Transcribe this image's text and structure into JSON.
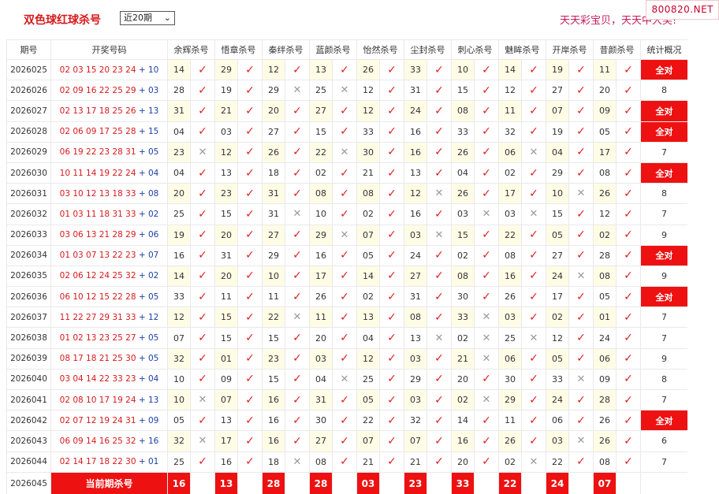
{
  "header": {
    "title": "双色球红球杀号",
    "select_value": "近20期",
    "slogan": "天天彩宝贝，天天中大奖!",
    "brand": "800820.NET"
  },
  "table": {
    "columns": [
      "期号",
      "开奖号码",
      "余辉杀号",
      "悟章杀号",
      "秦绊杀号",
      "蓝颜杀号",
      "怡然杀号",
      "尘封杀号",
      "刺心杀号",
      "魅眸杀号",
      "开岸杀号",
      "昔颜杀号",
      "统计概况"
    ],
    "rows": [
      {
        "issue": "2026025",
        "red": "02 03 15 20 23 24",
        "blue": "10",
        "kills": [
          [
            "14",
            "y"
          ],
          [
            "29",
            "y"
          ],
          [
            "12",
            "y"
          ],
          [
            "13",
            "y"
          ],
          [
            "26",
            "y"
          ],
          [
            "33",
            "y"
          ],
          [
            "10",
            "y"
          ],
          [
            "14",
            "y"
          ],
          [
            "19",
            "y"
          ],
          [
            "11",
            "y"
          ]
        ],
        "stat": "全对"
      },
      {
        "issue": "2026026",
        "red": "02 09 16 22 25 29",
        "blue": "03",
        "kills": [
          [
            "28",
            "y"
          ],
          [
            "19",
            "y"
          ],
          [
            "29",
            "n"
          ],
          [
            "25",
            "n"
          ],
          [
            "12",
            "y"
          ],
          [
            "31",
            "y"
          ],
          [
            "15",
            "y"
          ],
          [
            "12",
            "y"
          ],
          [
            "27",
            "y"
          ],
          [
            "20",
            "y"
          ]
        ],
        "stat": "8"
      },
      {
        "issue": "2026027",
        "red": "02 13 17 18 25 26",
        "blue": "13",
        "kills": [
          [
            "31",
            "y"
          ],
          [
            "21",
            "y"
          ],
          [
            "20",
            "y"
          ],
          [
            "27",
            "y"
          ],
          [
            "12",
            "y"
          ],
          [
            "24",
            "y"
          ],
          [
            "08",
            "y"
          ],
          [
            "11",
            "y"
          ],
          [
            "07",
            "y"
          ],
          [
            "09",
            "y"
          ]
        ],
        "stat": "全对"
      },
      {
        "issue": "2026028",
        "red": "02 06 09 17 25 28",
        "blue": "15",
        "kills": [
          [
            "04",
            "y"
          ],
          [
            "03",
            "y"
          ],
          [
            "27",
            "y"
          ],
          [
            "15",
            "y"
          ],
          [
            "33",
            "y"
          ],
          [
            "16",
            "y"
          ],
          [
            "33",
            "y"
          ],
          [
            "32",
            "y"
          ],
          [
            "19",
            "y"
          ],
          [
            "05",
            "y"
          ]
        ],
        "stat": "全对"
      },
      {
        "issue": "2026029",
        "red": "06 19 22 23 28 31",
        "blue": "05",
        "kills": [
          [
            "23",
            "n"
          ],
          [
            "12",
            "y"
          ],
          [
            "26",
            "y"
          ],
          [
            "22",
            "n"
          ],
          [
            "30",
            "y"
          ],
          [
            "16",
            "y"
          ],
          [
            "26",
            "y"
          ],
          [
            "06",
            "n"
          ],
          [
            "04",
            "y"
          ],
          [
            "17",
            "y"
          ]
        ],
        "stat": "7"
      },
      {
        "issue": "2026030",
        "red": "10 11 14 19 22 24",
        "blue": "04",
        "kills": [
          [
            "04",
            "y"
          ],
          [
            "13",
            "y"
          ],
          [
            "18",
            "y"
          ],
          [
            "02",
            "y"
          ],
          [
            "21",
            "y"
          ],
          [
            "13",
            "y"
          ],
          [
            "04",
            "y"
          ],
          [
            "02",
            "y"
          ],
          [
            "29",
            "y"
          ],
          [
            "08",
            "y"
          ]
        ],
        "stat": "全对"
      },
      {
        "issue": "2026031",
        "red": "03 10 12 13 18 33",
        "blue": "08",
        "kills": [
          [
            "20",
            "y"
          ],
          [
            "23",
            "y"
          ],
          [
            "31",
            "y"
          ],
          [
            "08",
            "y"
          ],
          [
            "08",
            "y"
          ],
          [
            "12",
            "n"
          ],
          [
            "26",
            "y"
          ],
          [
            "17",
            "y"
          ],
          [
            "10",
            "n"
          ],
          [
            "26",
            "y"
          ]
        ],
        "stat": "8"
      },
      {
        "issue": "2026032",
        "red": "01 03 11 18 31 33",
        "blue": "02",
        "kills": [
          [
            "25",
            "y"
          ],
          [
            "15",
            "y"
          ],
          [
            "31",
            "n"
          ],
          [
            "10",
            "y"
          ],
          [
            "02",
            "y"
          ],
          [
            "16",
            "y"
          ],
          [
            "03",
            "n"
          ],
          [
            "03",
            "n"
          ],
          [
            "15",
            "y"
          ],
          [
            "12",
            "y"
          ]
        ],
        "stat": "7"
      },
      {
        "issue": "2026033",
        "red": "03 06 13 21 28 29",
        "blue": "06",
        "kills": [
          [
            "19",
            "y"
          ],
          [
            "20",
            "y"
          ],
          [
            "27",
            "y"
          ],
          [
            "29",
            "n"
          ],
          [
            "07",
            "y"
          ],
          [
            "03",
            "n"
          ],
          [
            "15",
            "y"
          ],
          [
            "22",
            "y"
          ],
          [
            "05",
            "y"
          ],
          [
            "02",
            "y"
          ]
        ],
        "stat": "9"
      },
      {
        "issue": "2026034",
        "red": "01 03 07 13 22 23",
        "blue": "07",
        "kills": [
          [
            "16",
            "y"
          ],
          [
            "31",
            "y"
          ],
          [
            "29",
            "y"
          ],
          [
            "16",
            "y"
          ],
          [
            "05",
            "y"
          ],
          [
            "24",
            "y"
          ],
          [
            "02",
            "y"
          ],
          [
            "08",
            "y"
          ],
          [
            "27",
            "y"
          ],
          [
            "28",
            "y"
          ]
        ],
        "stat": "全对"
      },
      {
        "issue": "2026035",
        "red": "02 06 12 24 25 32",
        "blue": "02",
        "kills": [
          [
            "14",
            "y"
          ],
          [
            "20",
            "y"
          ],
          [
            "10",
            "y"
          ],
          [
            "17",
            "y"
          ],
          [
            "14",
            "y"
          ],
          [
            "27",
            "y"
          ],
          [
            "08",
            "y"
          ],
          [
            "16",
            "y"
          ],
          [
            "24",
            "n"
          ],
          [
            "08",
            "y"
          ]
        ],
        "stat": "9"
      },
      {
        "issue": "2026036",
        "red": "06 10 12 15 22 28",
        "blue": "05",
        "kills": [
          [
            "33",
            "y"
          ],
          [
            "11",
            "y"
          ],
          [
            "11",
            "y"
          ],
          [
            "26",
            "y"
          ],
          [
            "02",
            "y"
          ],
          [
            "31",
            "y"
          ],
          [
            "30",
            "y"
          ],
          [
            "26",
            "y"
          ],
          [
            "17",
            "y"
          ],
          [
            "05",
            "y"
          ]
        ],
        "stat": "全对"
      },
      {
        "issue": "2026037",
        "red": "11 22 27 29 31 33",
        "blue": "12",
        "kills": [
          [
            "12",
            "y"
          ],
          [
            "15",
            "y"
          ],
          [
            "22",
            "n"
          ],
          [
            "11",
            "y"
          ],
          [
            "13",
            "y"
          ],
          [
            "08",
            "y"
          ],
          [
            "33",
            "n"
          ],
          [
            "03",
            "y"
          ],
          [
            "02",
            "y"
          ],
          [
            "01",
            "y"
          ]
        ],
        "stat": "7"
      },
      {
        "issue": "2026038",
        "red": "01 02 13 23 25 27",
        "blue": "05",
        "kills": [
          [
            "07",
            "y"
          ],
          [
            "15",
            "y"
          ],
          [
            "15",
            "y"
          ],
          [
            "20",
            "y"
          ],
          [
            "04",
            "y"
          ],
          [
            "13",
            "n"
          ],
          [
            "02",
            "n"
          ],
          [
            "25",
            "n"
          ],
          [
            "12",
            "y"
          ],
          [
            "24",
            "y"
          ]
        ],
        "stat": "7"
      },
      {
        "issue": "2026039",
        "red": "08 17 18 21 25 30",
        "blue": "05",
        "kills": [
          [
            "32",
            "y"
          ],
          [
            "01",
            "y"
          ],
          [
            "23",
            "y"
          ],
          [
            "03",
            "y"
          ],
          [
            "12",
            "y"
          ],
          [
            "03",
            "y"
          ],
          [
            "21",
            "n"
          ],
          [
            "06",
            "y"
          ],
          [
            "05",
            "y"
          ],
          [
            "06",
            "y"
          ]
        ],
        "stat": "9"
      },
      {
        "issue": "2026040",
        "red": "03 04 14 22 33 23",
        "blue": "04",
        "kills": [
          [
            "10",
            "y"
          ],
          [
            "09",
            "y"
          ],
          [
            "15",
            "y"
          ],
          [
            "04",
            "n"
          ],
          [
            "25",
            "y"
          ],
          [
            "29",
            "y"
          ],
          [
            "20",
            "y"
          ],
          [
            "30",
            "y"
          ],
          [
            "33",
            "n"
          ],
          [
            "09",
            "y"
          ]
        ],
        "stat": "8"
      },
      {
        "issue": "2026041",
        "red": "02 08 10 17 19 24",
        "blue": "13",
        "kills": [
          [
            "10",
            "n"
          ],
          [
            "07",
            "y"
          ],
          [
            "16",
            "y"
          ],
          [
            "31",
            "y"
          ],
          [
            "05",
            "y"
          ],
          [
            "03",
            "y"
          ],
          [
            "02",
            "n"
          ],
          [
            "29",
            "y"
          ],
          [
            "24",
            "y"
          ],
          [
            "28",
            "y"
          ]
        ],
        "stat": "7"
      },
      {
        "issue": "2026042",
        "red": "02 07 12 19 24 31",
        "blue": "09",
        "kills": [
          [
            "05",
            "y"
          ],
          [
            "13",
            "y"
          ],
          [
            "16",
            "y"
          ],
          [
            "30",
            "y"
          ],
          [
            "22",
            "y"
          ],
          [
            "32",
            "y"
          ],
          [
            "14",
            "y"
          ],
          [
            "11",
            "y"
          ],
          [
            "06",
            "y"
          ],
          [
            "26",
            "y"
          ]
        ],
        "stat": "全对"
      },
      {
        "issue": "2026043",
        "red": "06 09 14 16 25 32",
        "blue": "16",
        "kills": [
          [
            "32",
            "n"
          ],
          [
            "17",
            "y"
          ],
          [
            "16",
            "y"
          ],
          [
            "27",
            "y"
          ],
          [
            "07",
            "y"
          ],
          [
            "07",
            "y"
          ],
          [
            "16",
            "y"
          ],
          [
            "26",
            "y"
          ],
          [
            "03",
            "n"
          ],
          [
            "26",
            "y"
          ]
        ],
        "stat": "6"
      },
      {
        "issue": "2026044",
        "red": "02 14 17 18 22 30",
        "blue": "01",
        "kills": [
          [
            "25",
            "y"
          ],
          [
            "16",
            "y"
          ],
          [
            "18",
            "n"
          ],
          [
            "08",
            "y"
          ],
          [
            "21",
            "y"
          ],
          [
            "21",
            "y"
          ],
          [
            "20",
            "y"
          ],
          [
            "02",
            "n"
          ],
          [
            "22",
            "y"
          ],
          [
            "08",
            "y"
          ]
        ],
        "stat": "7"
      }
    ],
    "current": {
      "issue": "2026045",
      "label": "当前期杀号",
      "values": [
        "16",
        "13",
        "28",
        "28",
        "03",
        "23",
        "33",
        "22",
        "24",
        "07"
      ]
    }
  },
  "colors": {
    "accent": "#ee1111",
    "red_text": "#d7191c",
    "blue_text": "#1b3fa8",
    "check": "#dd2222",
    "cross": "#9a9a9a",
    "row_tint": "#fffce6"
  }
}
